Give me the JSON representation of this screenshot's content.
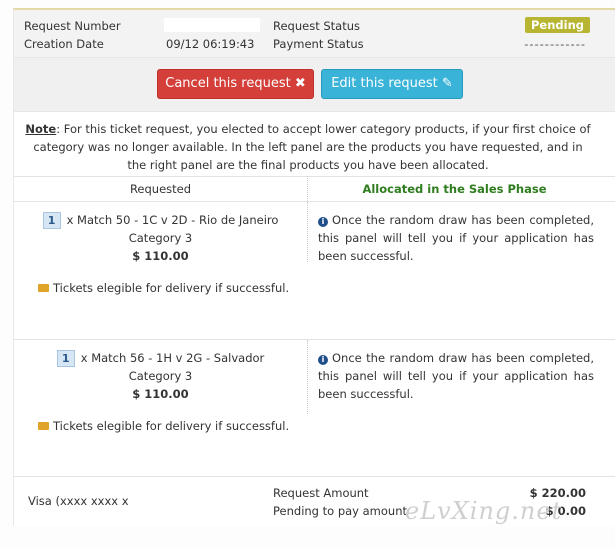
{
  "header": {
    "request_number_label": "Request Number",
    "creation_date_label": "Creation Date",
    "creation_date_value": "09/12 06:19:43",
    "request_status_label": "Request Status",
    "request_status_value": "Pending",
    "payment_status_label": "Payment Status",
    "payment_status_value": "-------------"
  },
  "actions": {
    "cancel_label": "Cancel this request ✖",
    "edit_label": "Edit this request ✎"
  },
  "note": {
    "title": "Note",
    "text": ": For this ticket request, you elected to accept lower category products, if your first choice of category was no longer available. In the left panel are the products you have requested, and in the right panel are the final products you have been allocated."
  },
  "columns": {
    "requested": "Requested",
    "allocated": "Allocated in the Sales Phase"
  },
  "items": [
    {
      "qty": "1",
      "match": "x Match 50 - 1C v 2D - Rio de Janeiro",
      "category": "Category 3",
      "price": "$ 110.00",
      "allocation_text": "Once the random draw has been completed, this panel will tell you if your application has been successful.",
      "eligibility": "Tickets elegible for delivery if successful."
    },
    {
      "qty": "1",
      "match": "x Match 56 - 1H v 2G - Salvador",
      "category": "Category 3",
      "price": "$ 110.00",
      "allocation_text": "Once the random draw has been completed, this panel will tell you if your application has been successful.",
      "eligibility": "Tickets elegible for delivery if successful."
    }
  ],
  "footer": {
    "card": "Visa (xxxx xxxx x",
    "request_amount_label": "Request Amount",
    "request_amount_value": "$ 220.00",
    "pending_label": "Pending to pay amount",
    "pending_value": "$ 0.00"
  },
  "watermark": "eLvXing.net",
  "colors": {
    "pending_badge": "#b7b531",
    "cancel_button": "#d43f3a",
    "edit_button": "#39b3d7",
    "allocated_heading": "#2e7d1e"
  },
  "icons": {
    "cancel": "times-icon",
    "edit": "edit-icon",
    "info": "info-circle-icon",
    "envelope": "envelope-icon"
  }
}
